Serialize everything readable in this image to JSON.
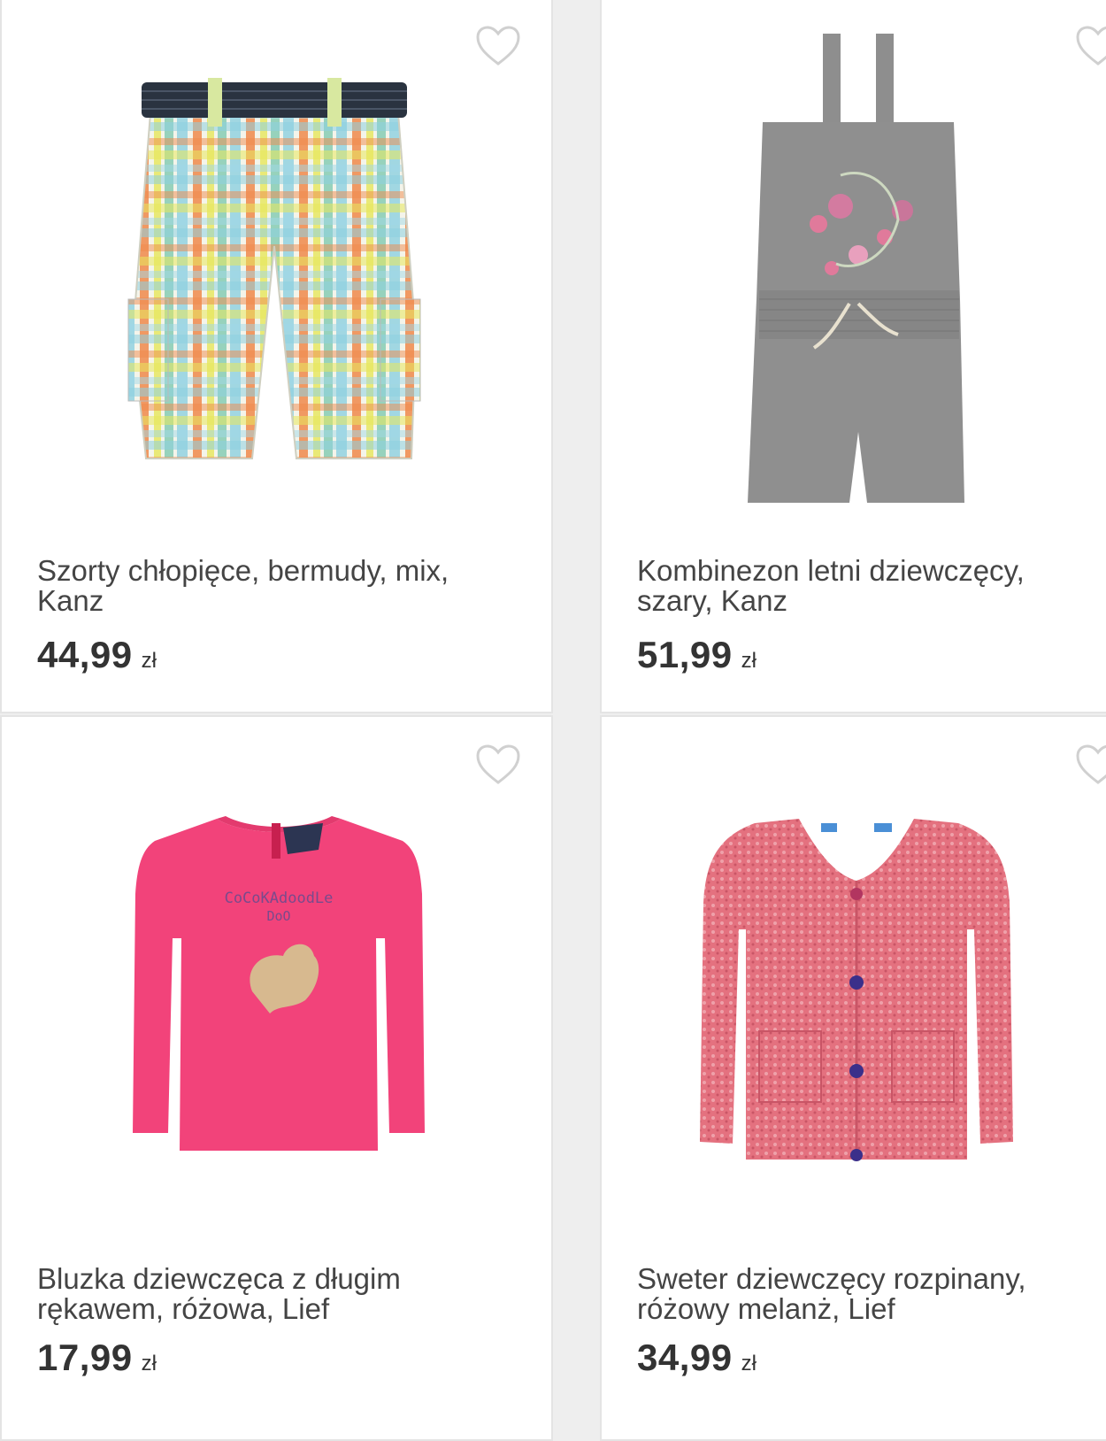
{
  "products": [
    {
      "title_line1": "Szorty chłopięce, bermudy, mix,",
      "title_line2": "Kanz",
      "price": "44,99",
      "currency": "zł",
      "image_icon": "plaid-shorts-image"
    },
    {
      "title_line1": "Kombinezon letni dziewczęcy,",
      "title_line2": "szary, Kanz",
      "price": "51,99",
      "currency": "zł",
      "image_icon": "grey-jumpsuit-image"
    },
    {
      "title_line1": "Bluzka dziewczęca z długim",
      "title_line2": "rękawem, różowa, Lief",
      "price": "17,99",
      "currency": "zł",
      "image_icon": "pink-longsleeve-image"
    },
    {
      "title_line1": "Sweter dziewczęcy rozpinany,",
      "title_line2": "różowy melanż, Lief",
      "price": "34,99",
      "currency": "zł",
      "image_icon": "pink-cardigan-image"
    }
  ],
  "shirt_print": {
    "line1": "CoCoKAdoodLe",
    "line2": "DoO"
  },
  "colors": {
    "heart_outline": "#d0d0d0",
    "card_border": "#e4e4e4",
    "text": "#444444"
  }
}
